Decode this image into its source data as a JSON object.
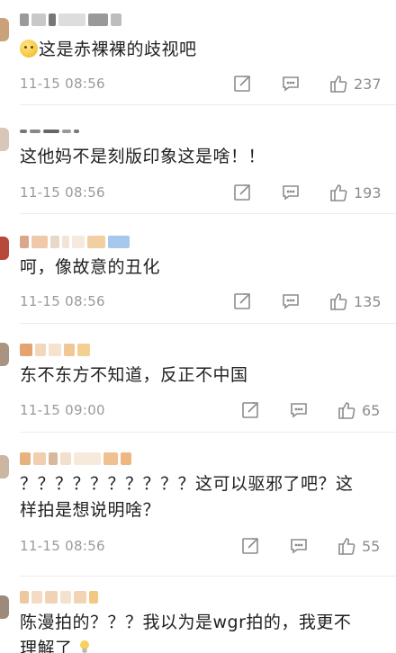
{
  "icons": {
    "repost": "repost-icon",
    "comment": "comment-icon",
    "like": "thumbs-up-icon"
  },
  "colors": {
    "text": "#1f1f1f",
    "meta": "#9a9a9a",
    "icon": "#8c8c8c",
    "divider": "#ececec"
  },
  "comments": [
    {
      "text": "这是赤裸裸的歧视吧",
      "time": "11-15 08:56",
      "likes": "237",
      "emoji_prefix": true
    },
    {
      "text": "这他妈不是刻版印象这是啥！！",
      "time": "11-15 08:56",
      "likes": "193"
    },
    {
      "text": "呵，像故意的丑化",
      "time": "11-15 08:56",
      "likes": "135"
    },
    {
      "text": "东不东方不知道，反正不中国",
      "time": "11-15 09:00",
      "likes": "65"
    },
    {
      "text_line1": "？？？？？？？？？？这可以驱邪了吧？这",
      "text_line2": "样拍是想说明啥？",
      "time": "11-15 08:56",
      "likes": "55"
    },
    {
      "text_line1": "陈漫拍的？？？我以为是wgr拍的，我更不",
      "text_line2": "理解了"
    }
  ]
}
